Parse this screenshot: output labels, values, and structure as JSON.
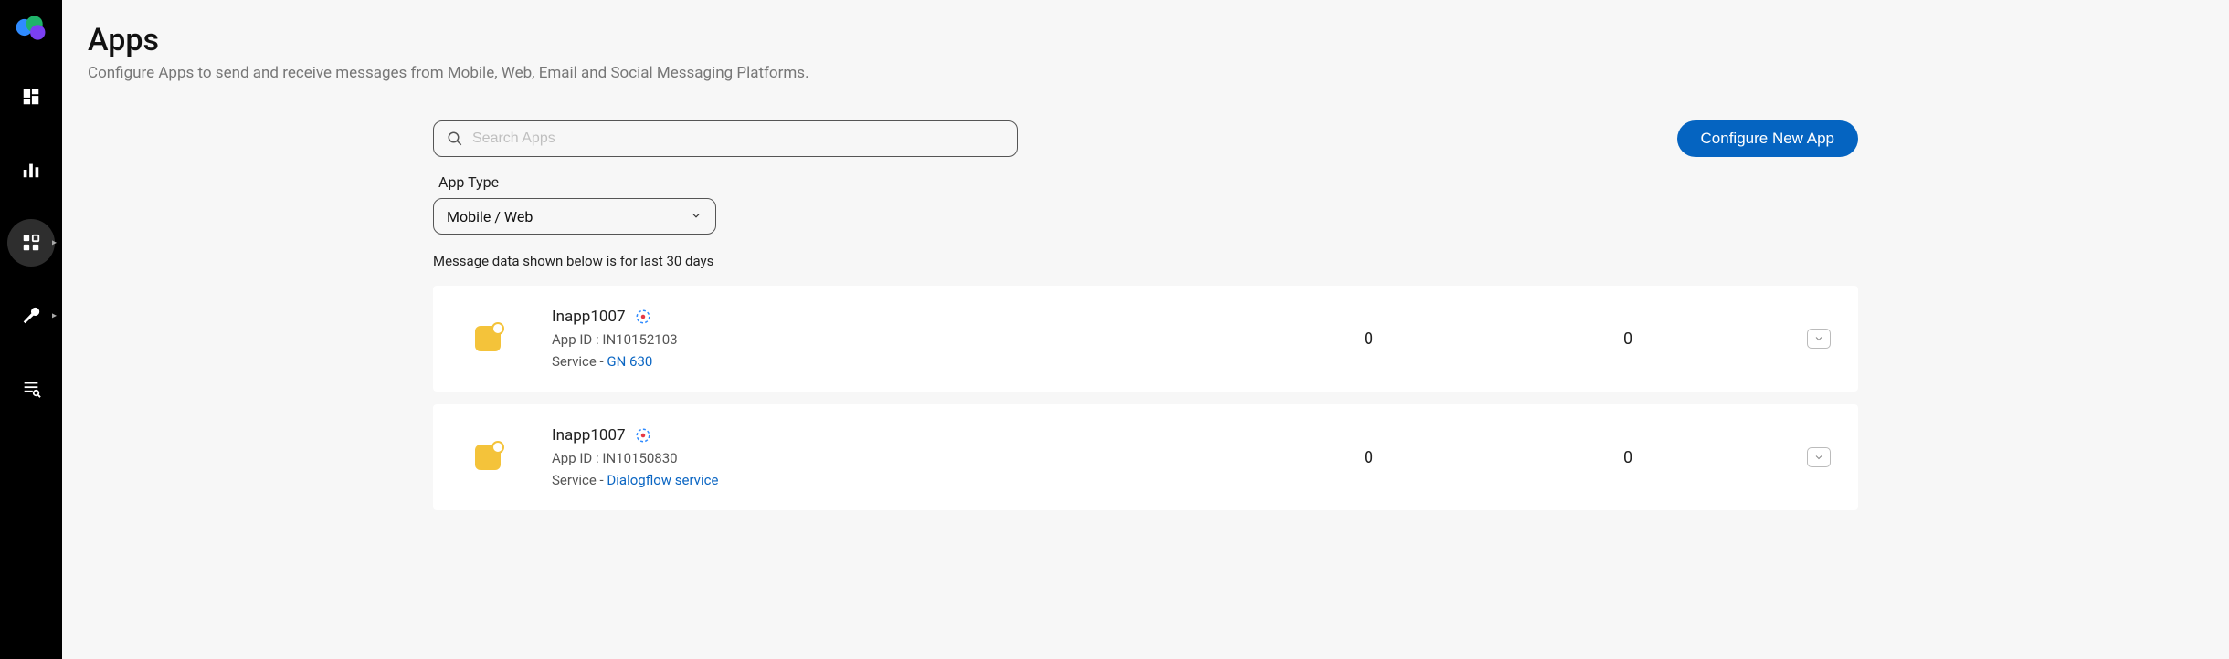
{
  "sidebar": {
    "items": [
      {
        "name": "dashboard-icon"
      },
      {
        "name": "analytics-icon"
      },
      {
        "name": "apps-icon",
        "active": true,
        "caret": true
      },
      {
        "name": "settings-icon",
        "caret": true
      },
      {
        "name": "logs-icon"
      }
    ]
  },
  "header": {
    "title": "Apps",
    "subtitle": "Configure Apps to send and receive messages from Mobile, Web, Email and Social Messaging Platforms."
  },
  "search": {
    "placeholder": "Search Apps",
    "value": ""
  },
  "filter": {
    "label": "App Type",
    "value": "Mobile / Web"
  },
  "note": "Message data shown below is for last 30 days",
  "cta": "Configure New App",
  "apps": [
    {
      "name": "Inapp1007",
      "app_id_label": "App ID :",
      "app_id": "IN10152103",
      "service_label": "Service",
      "service_sep": "-",
      "service": "GN 630",
      "count1": "0",
      "count2": "0"
    },
    {
      "name": "Inapp1007",
      "app_id_label": "App ID :",
      "app_id": "IN10150830",
      "service_label": "Service",
      "service_sep": "-",
      "service": "Dialogflow service",
      "count1": "0",
      "count2": "0"
    }
  ]
}
